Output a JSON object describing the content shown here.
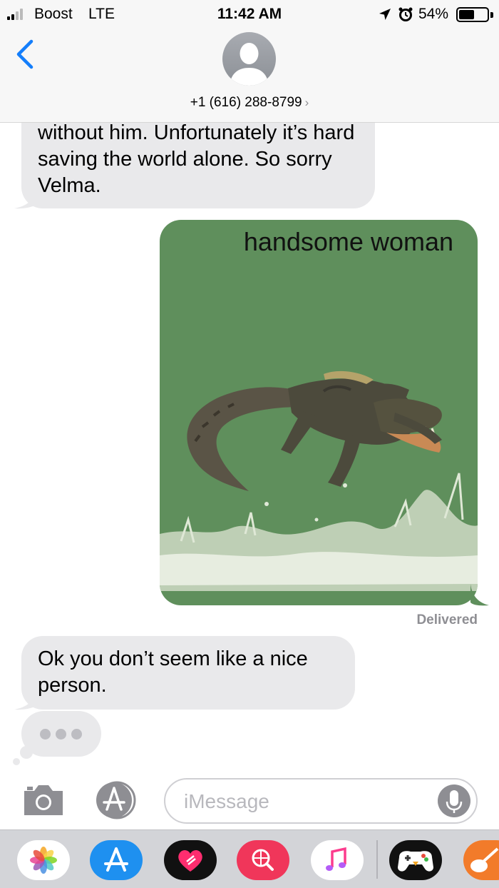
{
  "status_bar": {
    "carrier": "Boost",
    "network": "LTE",
    "time": "11:42 AM",
    "battery_percent": "54%",
    "battery_level": 0.54,
    "signal_bars": 2,
    "signal_bars_total": 4
  },
  "header": {
    "contact_number": "+1 (616) 288-8799",
    "chevron": "›",
    "back_icon": "chevron-left-icon",
    "avatar_icon": "person-silhouette-icon"
  },
  "messages": [
    {
      "direction": "incoming",
      "text": "without him. Unfortunately it’s hard saving the world alone. So sorry Velma."
    },
    {
      "direction": "outgoing",
      "type": "image",
      "image_caption": "handsome woman",
      "image_subject": "crocodile-jumping-from-water"
    },
    {
      "direction": "incoming",
      "text": "Ok you don’t seem like a nice person."
    }
  ],
  "delivery_status": "Delivered",
  "input_bar": {
    "placeholder": "iMessage",
    "camera_icon": "camera-icon",
    "appstore_icon": "app-store-icon",
    "mic_icon": "microphone-icon"
  },
  "app_drawer": [
    {
      "name": "Photos",
      "icon": "photos-flower-icon"
    },
    {
      "name": "App Store",
      "icon": "app-store-icon"
    },
    {
      "name": "Digital Touch",
      "icon": "heart-touch-icon"
    },
    {
      "name": "#images",
      "icon": "search-globe-icon"
    },
    {
      "name": "Music",
      "icon": "music-note-icon"
    },
    {
      "name": "Game Pigeon",
      "icon": "game-controller-icon"
    },
    {
      "name": "GarageBand",
      "icon": "guitar-icon"
    }
  ],
  "colors": {
    "ios_blue": "#147efb",
    "incoming_bubble": "#e9e9eb",
    "header_bg": "#f7f7f7",
    "image_bg": "#5f8f5c",
    "gray_text": "#8e8e93"
  }
}
